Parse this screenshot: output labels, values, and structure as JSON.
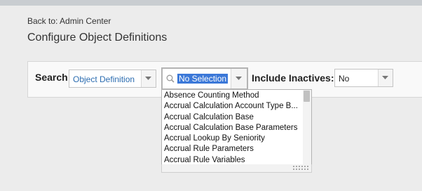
{
  "header": {
    "back_link": "Back to: Admin Center",
    "page_title": "Configure Object Definitions"
  },
  "search": {
    "label": "Search",
    "object_type": "Object Definition",
    "object_value": "No Selection",
    "include_inactives_label": "Include Inactives:",
    "include_inactives_value": "No"
  },
  "dropdown": {
    "items": [
      "Absence Counting Method",
      "Accrual Calculation Account Type B...",
      "Accrual Calculation Base",
      "Accrual Calculation Base Parameters",
      "Accrual Lookup By Seniority",
      "Accrual Rule Parameters",
      "Accrual Rule Variables"
    ]
  },
  "colors": {
    "background": "#ececec",
    "link_blue": "#2b6cb0",
    "selection_highlight": "#3b78d8"
  },
  "icons": {
    "search": "magnifier-icon",
    "dropdown_arrow": "chevron-down-icon",
    "resize": "resize-grip-icon"
  }
}
